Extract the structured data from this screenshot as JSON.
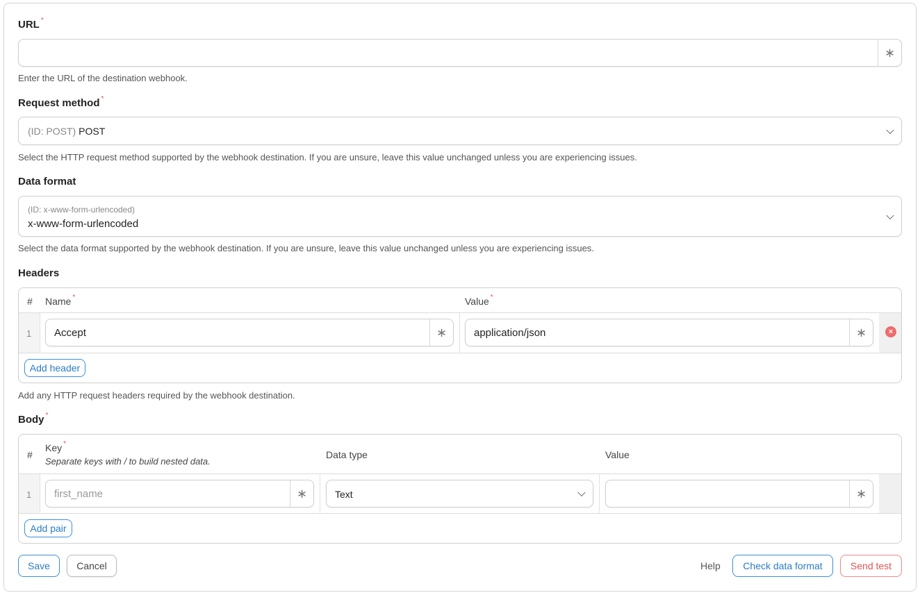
{
  "url": {
    "label": "URL",
    "value": "",
    "help": "Enter the URL of the destination webhook."
  },
  "request_method": {
    "label": "Request method",
    "id_text": "(ID: POST)",
    "value": "POST",
    "help": "Select the HTTP request method supported by the webhook destination. If you are unsure, leave this value unchanged unless you are experiencing issues."
  },
  "data_format": {
    "label": "Data format",
    "id_text": "(ID: x-www-form-urlencoded)",
    "value": "x-www-form-urlencoded",
    "help": "Select the data format supported by the webhook destination. If you are unsure, leave this value unchanged unless you are experiencing issues."
  },
  "headers": {
    "label": "Headers",
    "columns": {
      "num": "#",
      "name": "Name",
      "value": "Value"
    },
    "rows": [
      {
        "num": "1",
        "name": "Accept",
        "value": "application/json"
      }
    ],
    "add_button": "Add header",
    "help": "Add any HTTP request headers required by the webhook destination."
  },
  "body": {
    "label": "Body",
    "columns": {
      "num": "#",
      "key": "Key",
      "key_hint": "Separate keys with / to build nested data.",
      "data_type": "Data type",
      "value": "Value"
    },
    "rows": [
      {
        "num": "1",
        "key_placeholder": "first_name",
        "data_type": "Text",
        "value": ""
      }
    ],
    "add_button": "Add pair"
  },
  "actions": {
    "save": "Save",
    "cancel": "Cancel",
    "help": "Help",
    "check": "Check data format",
    "send_test": "Send test"
  },
  "icons": {
    "asterisk": "∗",
    "remove": "remove-circle-icon"
  }
}
